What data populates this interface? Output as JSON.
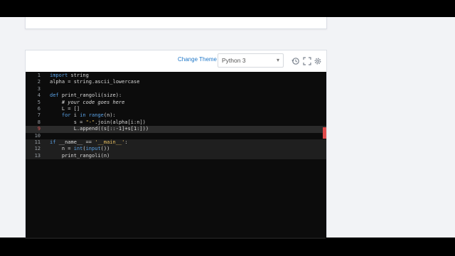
{
  "toolbar": {
    "change_theme": "Change Theme",
    "language": "Python 3",
    "icons": [
      "history-icon",
      "fullscreen-icon",
      "settings-icon"
    ]
  },
  "code": {
    "lines": [
      {
        "n": "1",
        "t": "import string"
      },
      {
        "n": "2",
        "t": "alpha = string.ascii_lowercase"
      },
      {
        "n": "3",
        "t": ""
      },
      {
        "n": "4",
        "t": "def print_rangoli(size):"
      },
      {
        "n": "5",
        "t": "    # your code goes here"
      },
      {
        "n": "6",
        "t": "    L = []"
      },
      {
        "n": "7",
        "t": "    for i in range(n):"
      },
      {
        "n": "8",
        "t": "        s = \"-\".join(alpha[i:n])"
      },
      {
        "n": "9",
        "t": "        L.append((s[::-1]+s[1:]))"
      },
      {
        "n": "10",
        "t": ""
      },
      {
        "n": "11",
        "t": "if __name__ == '__main__':"
      },
      {
        "n": "12",
        "t": "    n = int(input())"
      },
      {
        "n": "13",
        "t": "    print_rangoli(n)"
      }
    ]
  },
  "colors": {
    "accent_link": "#1f77c8",
    "editor_bg": "#0c0c0c",
    "keyword": "#5aa2e6",
    "string": "#e8c060",
    "error_marker": "#e04b4b"
  }
}
